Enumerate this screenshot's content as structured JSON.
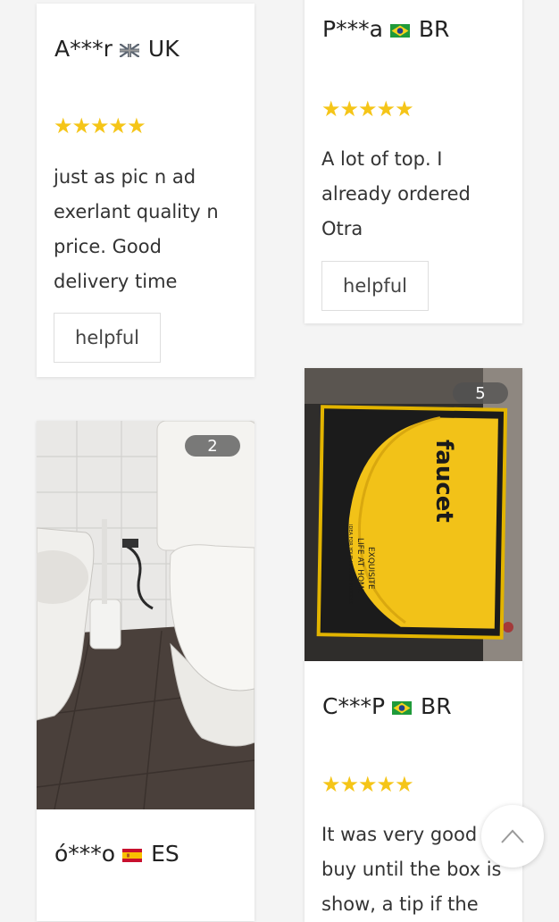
{
  "helpful_label": "helpful",
  "colors": {
    "star": "#f5c518",
    "page_bg": "#f4f4f4",
    "card_bg": "#ffffff"
  },
  "reviews": [
    {
      "author": "A***r",
      "flag": "uk-flag-icon",
      "country": "UK",
      "rating": 5,
      "stars": "★★★★★",
      "text_lines": [
        "just as pic n ad",
        "exerlant quality n",
        "price. Good",
        "delivery time"
      ]
    },
    {
      "author": "P***a",
      "flag": "brazil-flag-icon",
      "country": "BR",
      "rating": 5,
      "stars": "★★★★★",
      "text_lines": [
        "A lot of top. I",
        "already ordered",
        "Otra"
      ]
    },
    {
      "photo_count": "2",
      "author": "ó***o",
      "flag": "spain-flag-icon",
      "country": "ES"
    },
    {
      "photo_count": "5",
      "author": "C***P",
      "flag": "brazil-flag-icon",
      "country": "BR",
      "rating": 5,
      "stars": "★★★★★",
      "text_lines": [
        "It was very good",
        "buy until the box is",
        "show, a tip if the"
      ]
    }
  ],
  "box_photo": {
    "brand": "faucet",
    "line1": "EXQUISITE",
    "line2": "LIFE AT HOME",
    "line3": "IDEA FOR YOUR LIFE AND SUCCESS"
  }
}
